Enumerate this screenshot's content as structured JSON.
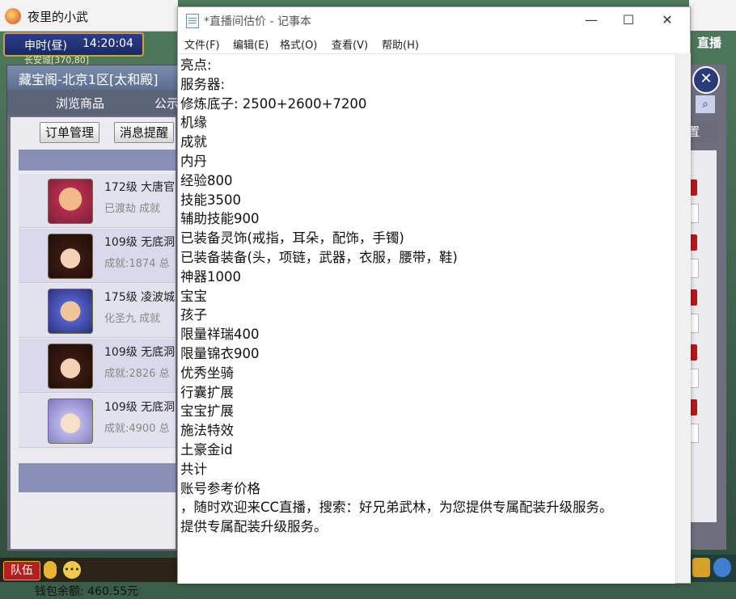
{
  "game": {
    "window_title": "夜里的小武",
    "hud_time_label": "申时(昼)",
    "hud_time_value": "14:20:04",
    "location": "长安城[370,80]",
    "cc_logo": "直播",
    "cbg": {
      "title": "藏宝阁-北京1区[太和殿]",
      "tabs": [
        "浏览商品",
        "公示"
      ],
      "buttons": {
        "orders": "订单管理",
        "messages": "消息提醒",
        "settings": "置"
      },
      "rows": [
        {
          "line1": "172级  大唐官",
          "line2": "已渡劫  成就"
        },
        {
          "line1": "109级  无底洞",
          "line2": "成就:1874  总"
        },
        {
          "line1": "175级  凌波城",
          "line2": "化圣九  成就"
        },
        {
          "line1": "109级  无底洞",
          "line2": "成就:2826  总"
        },
        {
          "line1": "109级  无底洞",
          "line2": "成就:4900  总"
        }
      ],
      "wallet": "钱包余额: 460.55元"
    },
    "team_button": "队伍",
    "icons": [
      "app-icon",
      "close-icon",
      "search-icon",
      "mic-icon",
      "chat-icon"
    ],
    "colors": {
      "panel_header": "#5c6f92",
      "list_head": "#8a8fb8",
      "badge_red": "#b8171b"
    }
  },
  "notepad": {
    "title": "*直播间估价 - 记事本",
    "controls": {
      "minimize": "—",
      "maximize": "☐",
      "close": "✕"
    },
    "menu": [
      "文件(F)",
      "编辑(E)",
      "格式(O)",
      "查看(V)",
      "帮助(H)"
    ],
    "lines": [
      "亮点:",
      "服务器:",
      "修炼底子: 2500+2600+7200",
      "机缘",
      "成就",
      "内丹",
      "经验800",
      "技能3500",
      "辅助技能900",
      "已装备灵饰(戒指，耳朵，配饰，手镯)",
      "已装备装备(头，项链，武器，衣服，腰带，鞋)",
      "神器1000",
      "宝宝",
      "孩子",
      "限量祥瑞400",
      "限量锦衣900",
      "优秀坐骑",
      "行囊扩展",
      "宝宝扩展",
      "施法特效",
      "土豪金id",
      "共计",
      "账号参考价格",
      "，随时欢迎来CC直播，搜索：好兄弟武林，为您提供专属配装升级服务。",
      "提供专属配装升级服务。"
    ]
  }
}
